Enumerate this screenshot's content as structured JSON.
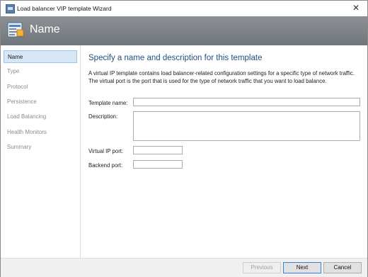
{
  "window": {
    "title": "Load balancer VIP template Wizard",
    "close_glyph": "✕"
  },
  "banner": {
    "title": "Name",
    "icon": "template-wizard-icon"
  },
  "sidebar": {
    "items": [
      {
        "label": "Name",
        "active": true
      },
      {
        "label": "Type",
        "active": false
      },
      {
        "label": "Protocol",
        "active": false
      },
      {
        "label": "Persistence",
        "active": false
      },
      {
        "label": "Load Balancing",
        "active": false
      },
      {
        "label": "Health Monitors",
        "active": false
      },
      {
        "label": "Summary",
        "active": false
      }
    ]
  },
  "main": {
    "heading": "Specify a name and description for this template",
    "description": "A virtual IP template contains load balancer-related configuration settings for a specific type of network traffic. The virtual port is the port that is used for the type of network traffic that you want to load balance.",
    "fields": {
      "template_name": {
        "label": "Template name:",
        "value": ""
      },
      "description": {
        "label": "Description:",
        "value": ""
      },
      "virtual_ip_port": {
        "label": "Virtual IP port:",
        "value": ""
      },
      "backend_port": {
        "label": "Backend port:",
        "value": ""
      }
    }
  },
  "footer": {
    "previous": "Previous",
    "next": "Next",
    "cancel": "Cancel"
  },
  "colors": {
    "heading": "#1f4f82",
    "banner": "#7f8388",
    "active_nav": "#d5e6f7"
  }
}
